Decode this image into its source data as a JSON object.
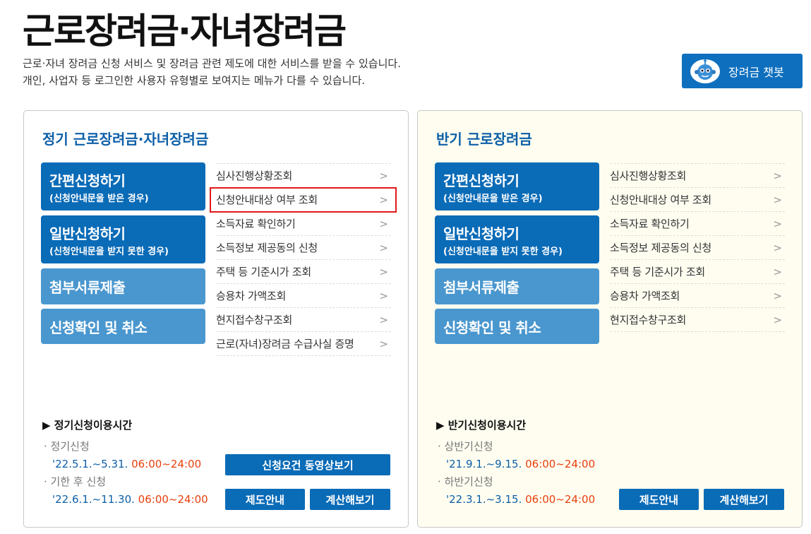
{
  "page": {
    "title": "근로장려금·자녀장려금",
    "desc_line1": "근로·자녀 장려금 신청 서비스 및 장려금 관련 제도에 대한 서비스를 받을 수 있습니다.",
    "desc_line2": "개인, 사업자 등 로그인한 사용자 유형별로 보여지는 메뉴가 다를 수 있습니다.",
    "chatbot_label": "장려금 챗봇"
  },
  "colors": {
    "primary": "#0a6bb7",
    "light": "#4a97cf",
    "title": "#0d5fa8",
    "accent": "#e8400c",
    "highlight": "#e01919",
    "right_bg": "#fefdf0"
  },
  "regular": {
    "title": "정기 근로장려금·자녀장려금",
    "btn_simple": "간편신청하기",
    "btn_simple_sub": "(신청안내문을 받은 경우)",
    "btn_general": "일반신청하기",
    "btn_general_sub": "(신청안내문을 받지 못한 경우)",
    "btn_attach": "첨부서류제출",
    "btn_confirm": "신청확인 및 취소",
    "menu": [
      "심사진행상황조회",
      "신청안내대상 여부 조회",
      "소득자료 확인하기",
      "소득정보 제공동의 신청",
      "주택 등 기준시가 조회",
      "승용차 가액조회",
      "현지접수창구조회",
      "근로(자녀)장려금 수급사실 증명"
    ],
    "time_title": "▶ 정기신청이용시간",
    "t1_label": "정기신청",
    "t1_date": "'22.5.1.~5.31.",
    "t1_hours": "06:00~24:00",
    "t2_label": "기한 후 신청",
    "t2_date": "'22.6.1.~11.30.",
    "t2_hours": "06:00~24:00",
    "btn_video": "신청요건 동영상보기",
    "btn_info": "제도안내",
    "btn_calc": "계산해보기"
  },
  "half": {
    "title": "반기 근로장려금",
    "btn_simple": "간편신청하기",
    "btn_simple_sub": "(신청안내문을 받은 경우)",
    "btn_general": "일반신청하기",
    "btn_general_sub": "(신청안내문을 받지 못한 경우)",
    "btn_attach": "첨부서류제출",
    "btn_confirm": "신청확인 및 취소",
    "menu": [
      "심사진행상황조회",
      "신청안내대상 여부 조회",
      "소득자료 확인하기",
      "소득정보 제공동의 신청",
      "주택 등 기준시가 조회",
      "승용차 가액조회",
      "현지접수창구조회"
    ],
    "time_title": "▶ 반기신청이용시간",
    "t1_label": "상반기신청",
    "t1_date": "'21.9.1.~9.15.",
    "t1_hours": "06:00~24:00",
    "t2_label": "하반기신청",
    "t2_date": "'22.3.1.~3.15.",
    "t2_hours": "06:00~24:00",
    "btn_info": "제도안내",
    "btn_calc": "계산해보기"
  }
}
